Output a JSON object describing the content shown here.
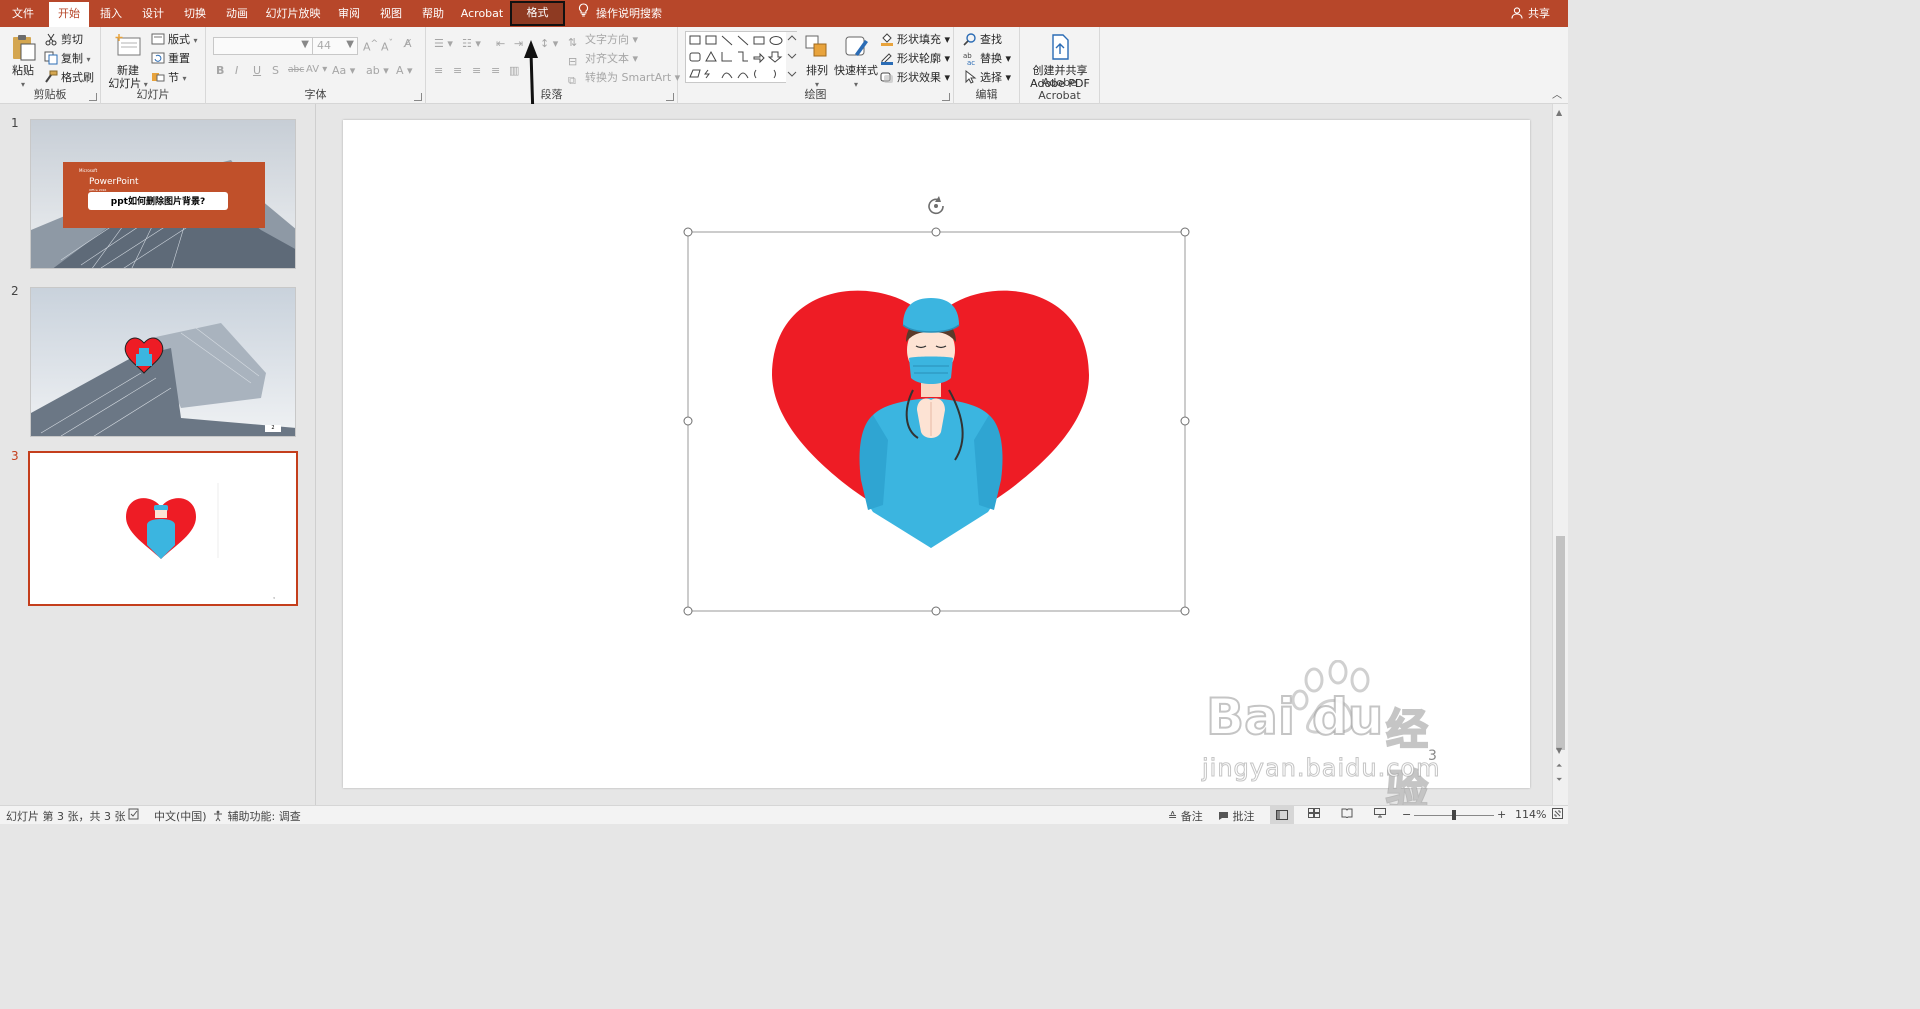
{
  "tabs": [
    {
      "id": "file",
      "label": "文件"
    },
    {
      "id": "home",
      "label": "开始",
      "active": true
    },
    {
      "id": "insert",
      "label": "插入"
    },
    {
      "id": "design",
      "label": "设计"
    },
    {
      "id": "transitions",
      "label": "切换"
    },
    {
      "id": "animations",
      "label": "动画"
    },
    {
      "id": "slideshow",
      "label": "幻灯片放映"
    },
    {
      "id": "review",
      "label": "审阅"
    },
    {
      "id": "view",
      "label": "视图"
    },
    {
      "id": "help",
      "label": "帮助"
    },
    {
      "id": "acrobat",
      "label": "Acrobat"
    },
    {
      "id": "format",
      "label": "格式",
      "contextual": true
    }
  ],
  "tell_me": "操作说明搜索",
  "share": "共享",
  "ribbon": {
    "clipboard": {
      "paste": "粘贴",
      "cut": "剪切",
      "copy": "复制",
      "format_painter": "格式刷",
      "label": "剪贴板"
    },
    "slides": {
      "new_slide_line1": "新建",
      "new_slide_line2": "幻灯片",
      "layout": "版式",
      "reset": "重置",
      "section": "节",
      "label": "幻灯片"
    },
    "font": {
      "size": "44",
      "label": "字体"
    },
    "paragraph": {
      "text_direction": "文字方向",
      "align_text": "对齐文本",
      "smartart": "转换为 SmartArt",
      "label": "段落"
    },
    "drawing": {
      "arrange": "排列",
      "quick_styles": "快速样式",
      "shape_fill": "形状填充",
      "shape_outline": "形状轮廓",
      "shape_effects": "形状效果",
      "label": "绘图"
    },
    "editing": {
      "find": "查找",
      "replace": "替换",
      "select": "选择",
      "label": "编辑"
    },
    "acrobat": {
      "create_share_line1": "创建并共享",
      "create_share_line2": "Adobe PDF",
      "label": "Adobe Acrobat"
    }
  },
  "thumbnails": [
    {
      "num": "1",
      "brand": "Microsoft",
      "app": "PowerPoint",
      "subtitle": "Office 2016",
      "title": "ppt如何删除图片背景?"
    },
    {
      "num": "2",
      "page": "2"
    },
    {
      "num": "3",
      "selected": true
    }
  ],
  "slide": {
    "page_number": "3"
  },
  "status": {
    "slide_info": "幻灯片 第 3 张，共 3 张",
    "language": "中文(中国)",
    "accessibility": "辅助功能: 调查",
    "notes": "备注",
    "comments": "批注",
    "zoom": "114%"
  },
  "watermark": {
    "brand_left": "Bai",
    "brand_right": "du",
    "brand_cn": "经验",
    "url": "jingyan.baidu.com"
  },
  "colors": {
    "accent": "#b7472a",
    "heart": "#ee1c25",
    "scrubs": "#3bb5e0"
  }
}
